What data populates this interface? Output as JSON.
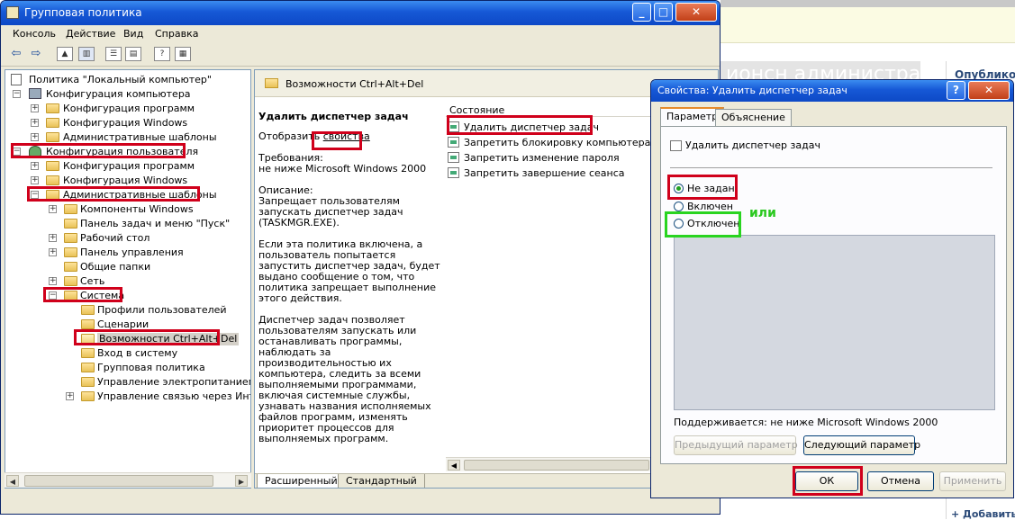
{
  "background": {
    "strip_text": "ионсн администрато",
    "published_label": "Опубликов",
    "add_label": "+ Добавить"
  },
  "window": {
    "title": "Групповая политика",
    "controls": {
      "minimize": "_",
      "maximize": "□",
      "close": "✕"
    },
    "menu": [
      "Консоль",
      "Действие",
      "Вид",
      "Справка"
    ]
  },
  "tree": {
    "items": [
      {
        "label": "Политика \"Локальный компьютер\"",
        "expander": "",
        "icon": "policy-doc"
      },
      {
        "label": "Конфигурация компьютера",
        "expander": "−",
        "icon": "computer"
      },
      {
        "label": "Конфигурация программ",
        "expander": "+",
        "icon": "folder"
      },
      {
        "label": "Конфигурация Windows",
        "expander": "+",
        "icon": "folder"
      },
      {
        "label": "Административные шаблоны",
        "expander": "+",
        "icon": "folder"
      },
      {
        "label": "Конфигурация пользователя",
        "expander": "−",
        "icon": "user"
      },
      {
        "label": "Конфигурация программ",
        "expander": "+",
        "icon": "folder"
      },
      {
        "label": "Конфигурация Windows",
        "expander": "+",
        "icon": "folder"
      },
      {
        "label": "Административные шаблоны",
        "expander": "−",
        "icon": "folder"
      },
      {
        "label": "Компоненты Windows",
        "expander": "+",
        "icon": "folder"
      },
      {
        "label": "Панель задач и меню \"Пуск\"",
        "expander": "",
        "icon": "folder"
      },
      {
        "label": "Рабочий стол",
        "expander": "+",
        "icon": "folder"
      },
      {
        "label": "Панель управления",
        "expander": "+",
        "icon": "folder"
      },
      {
        "label": "Общие папки",
        "expander": "",
        "icon": "folder"
      },
      {
        "label": "Сеть",
        "expander": "+",
        "icon": "folder"
      },
      {
        "label": "Система",
        "expander": "−",
        "icon": "folder"
      },
      {
        "label": "Профили пользователей",
        "expander": "",
        "icon": "folder"
      },
      {
        "label": "Сценарии",
        "expander": "",
        "icon": "folder"
      },
      {
        "label": "Возможности Ctrl+Alt+Del",
        "expander": "",
        "icon": "folder-open"
      },
      {
        "label": "Вход в систему",
        "expander": "",
        "icon": "folder"
      },
      {
        "label": "Групповая политика",
        "expander": "",
        "icon": "folder"
      },
      {
        "label": "Управление электропитанием",
        "expander": "",
        "icon": "folder"
      },
      {
        "label": "Управление связью через Интер",
        "expander": "+",
        "icon": "folder"
      }
    ],
    "selected": "Возможности Ctrl+Alt+Del"
  },
  "content": {
    "header": "Возможности Ctrl+Alt+Del",
    "policy_name": "Удалить диспетчер задач",
    "show_prefix": "Отобразить",
    "show_link": "свойства",
    "requirements": "Требования:\nне ниже Microsoft Windows 2000",
    "description_1": "Описание:\nЗапрещает пользователям запускать диспетчер задач (TASKMGR.EXE).",
    "description_2": "Если эта политика включена, а пользователь попытается запустить диспетчер задач, будет выдано сообщение о том, что политика запрещает выполнение этого действия.",
    "description_3": "Диспетчер задач позволяет пользователям запускать или останавливать программы, наблюдать за производительностью их компьютера, следить за всеми выполняемыми программами, включая системные службы, узнавать названия исполняемых файлов программ, изменять приоритет процессов для выполняемых программ.",
    "column_header": "Состояние",
    "list": [
      "Удалить диспетчер задач",
      "Запретить блокировку компьютера",
      "Запретить изменение пароля",
      "Запретить завершение сеанса"
    ],
    "tabs": [
      "Расширенный",
      "Стандартный"
    ]
  },
  "dialog": {
    "title": "Свойства: Удалить диспетчер задач",
    "help_button": "?",
    "close_button": "✕",
    "tabs": [
      "Параметр",
      "Объяснение"
    ],
    "policy_title": "Удалить диспетчер задач",
    "options": [
      {
        "label": "Не задан",
        "selected": true
      },
      {
        "label": "Включен",
        "selected": false
      },
      {
        "label": "Отключен",
        "selected": false
      }
    ],
    "annotation_or": "или",
    "supported": "Поддерживается:  не ниже Microsoft Windows 2000",
    "prev_button": "Предыдущий параметр",
    "next_button": "Следующий параметр",
    "ok_button": "ОК",
    "cancel_button": "Отмена",
    "apply_button": "Применить"
  },
  "colors": {
    "highlight_red": "#d0001b",
    "highlight_green": "#29d420",
    "xp_title_blue": "#1658d6"
  }
}
